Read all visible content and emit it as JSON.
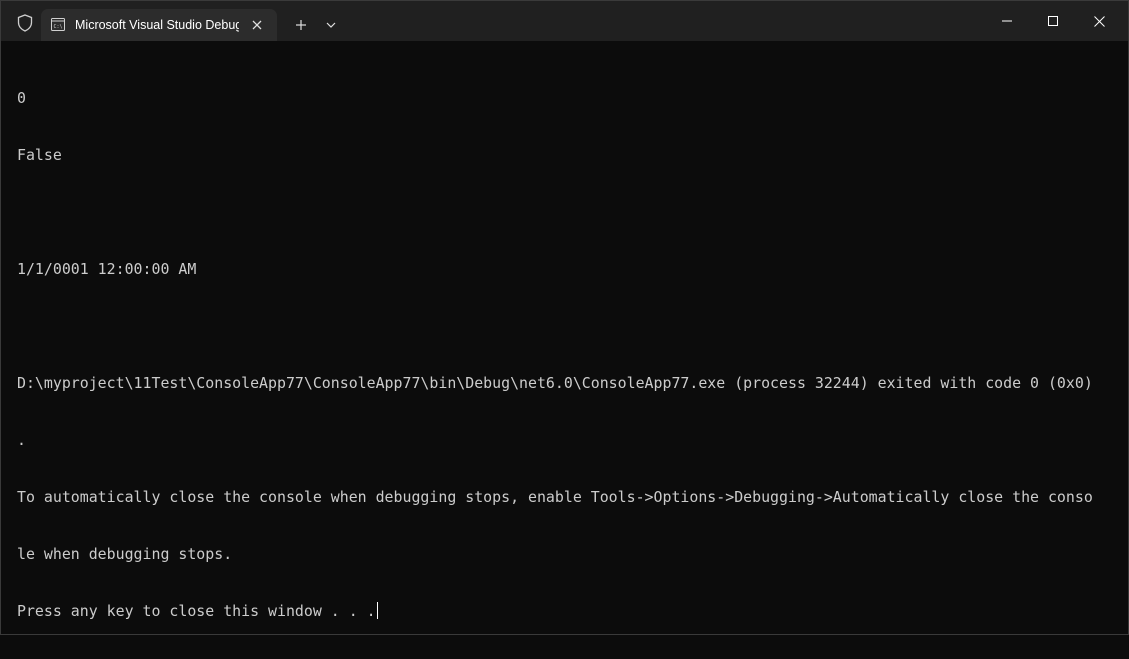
{
  "tab": {
    "title": "Microsoft Visual Studio Debug Console",
    "icon": "console-app-icon"
  },
  "titlebar_icons": {
    "shield": "shield-icon",
    "close_tab": "close-icon",
    "new_tab": "plus-icon",
    "dropdown": "chevron-down-icon",
    "minimize": "minimize-icon",
    "maximize": "maximize-icon",
    "close_window": "close-icon"
  },
  "console": {
    "lines": [
      "0",
      "False",
      "",
      "1/1/0001 12:00:00 AM",
      "",
      "D:\\myproject\\11Test\\ConsoleApp77\\ConsoleApp77\\bin\\Debug\\net6.0\\ConsoleApp77.exe (process 32244) exited with code 0 (0x0)",
      ".",
      "To automatically close the console when debugging stops, enable Tools->Options->Debugging->Automatically close the conso",
      "le when debugging stops.",
      "Press any key to close this window . . ."
    ]
  },
  "colors": {
    "titlebar_bg": "#202020",
    "tab_bg": "#2c2c2c",
    "console_bg": "#0c0c0c",
    "console_text": "#cccccc"
  }
}
